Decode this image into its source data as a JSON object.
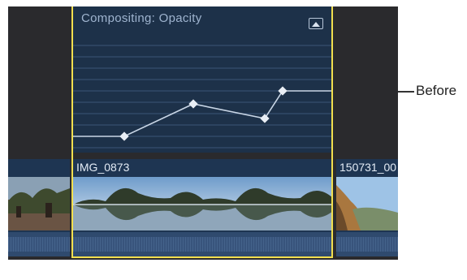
{
  "animation_editor": {
    "title": "Compositing: Opacity",
    "collapse_icon": "collapse-editor-icon",
    "keyframe_count": 4
  },
  "clips": [
    {
      "label": ""
    },
    {
      "label": "IMG_0873"
    },
    {
      "label": "150731_00"
    }
  ],
  "callout": {
    "label": "Before"
  },
  "colors": {
    "timeline_bg": "#2a2a2d",
    "editor_bg": "#1d3149",
    "selection": "#f2df4e",
    "clip_bg": "#1e3552",
    "curve": "#c9d6e6"
  }
}
